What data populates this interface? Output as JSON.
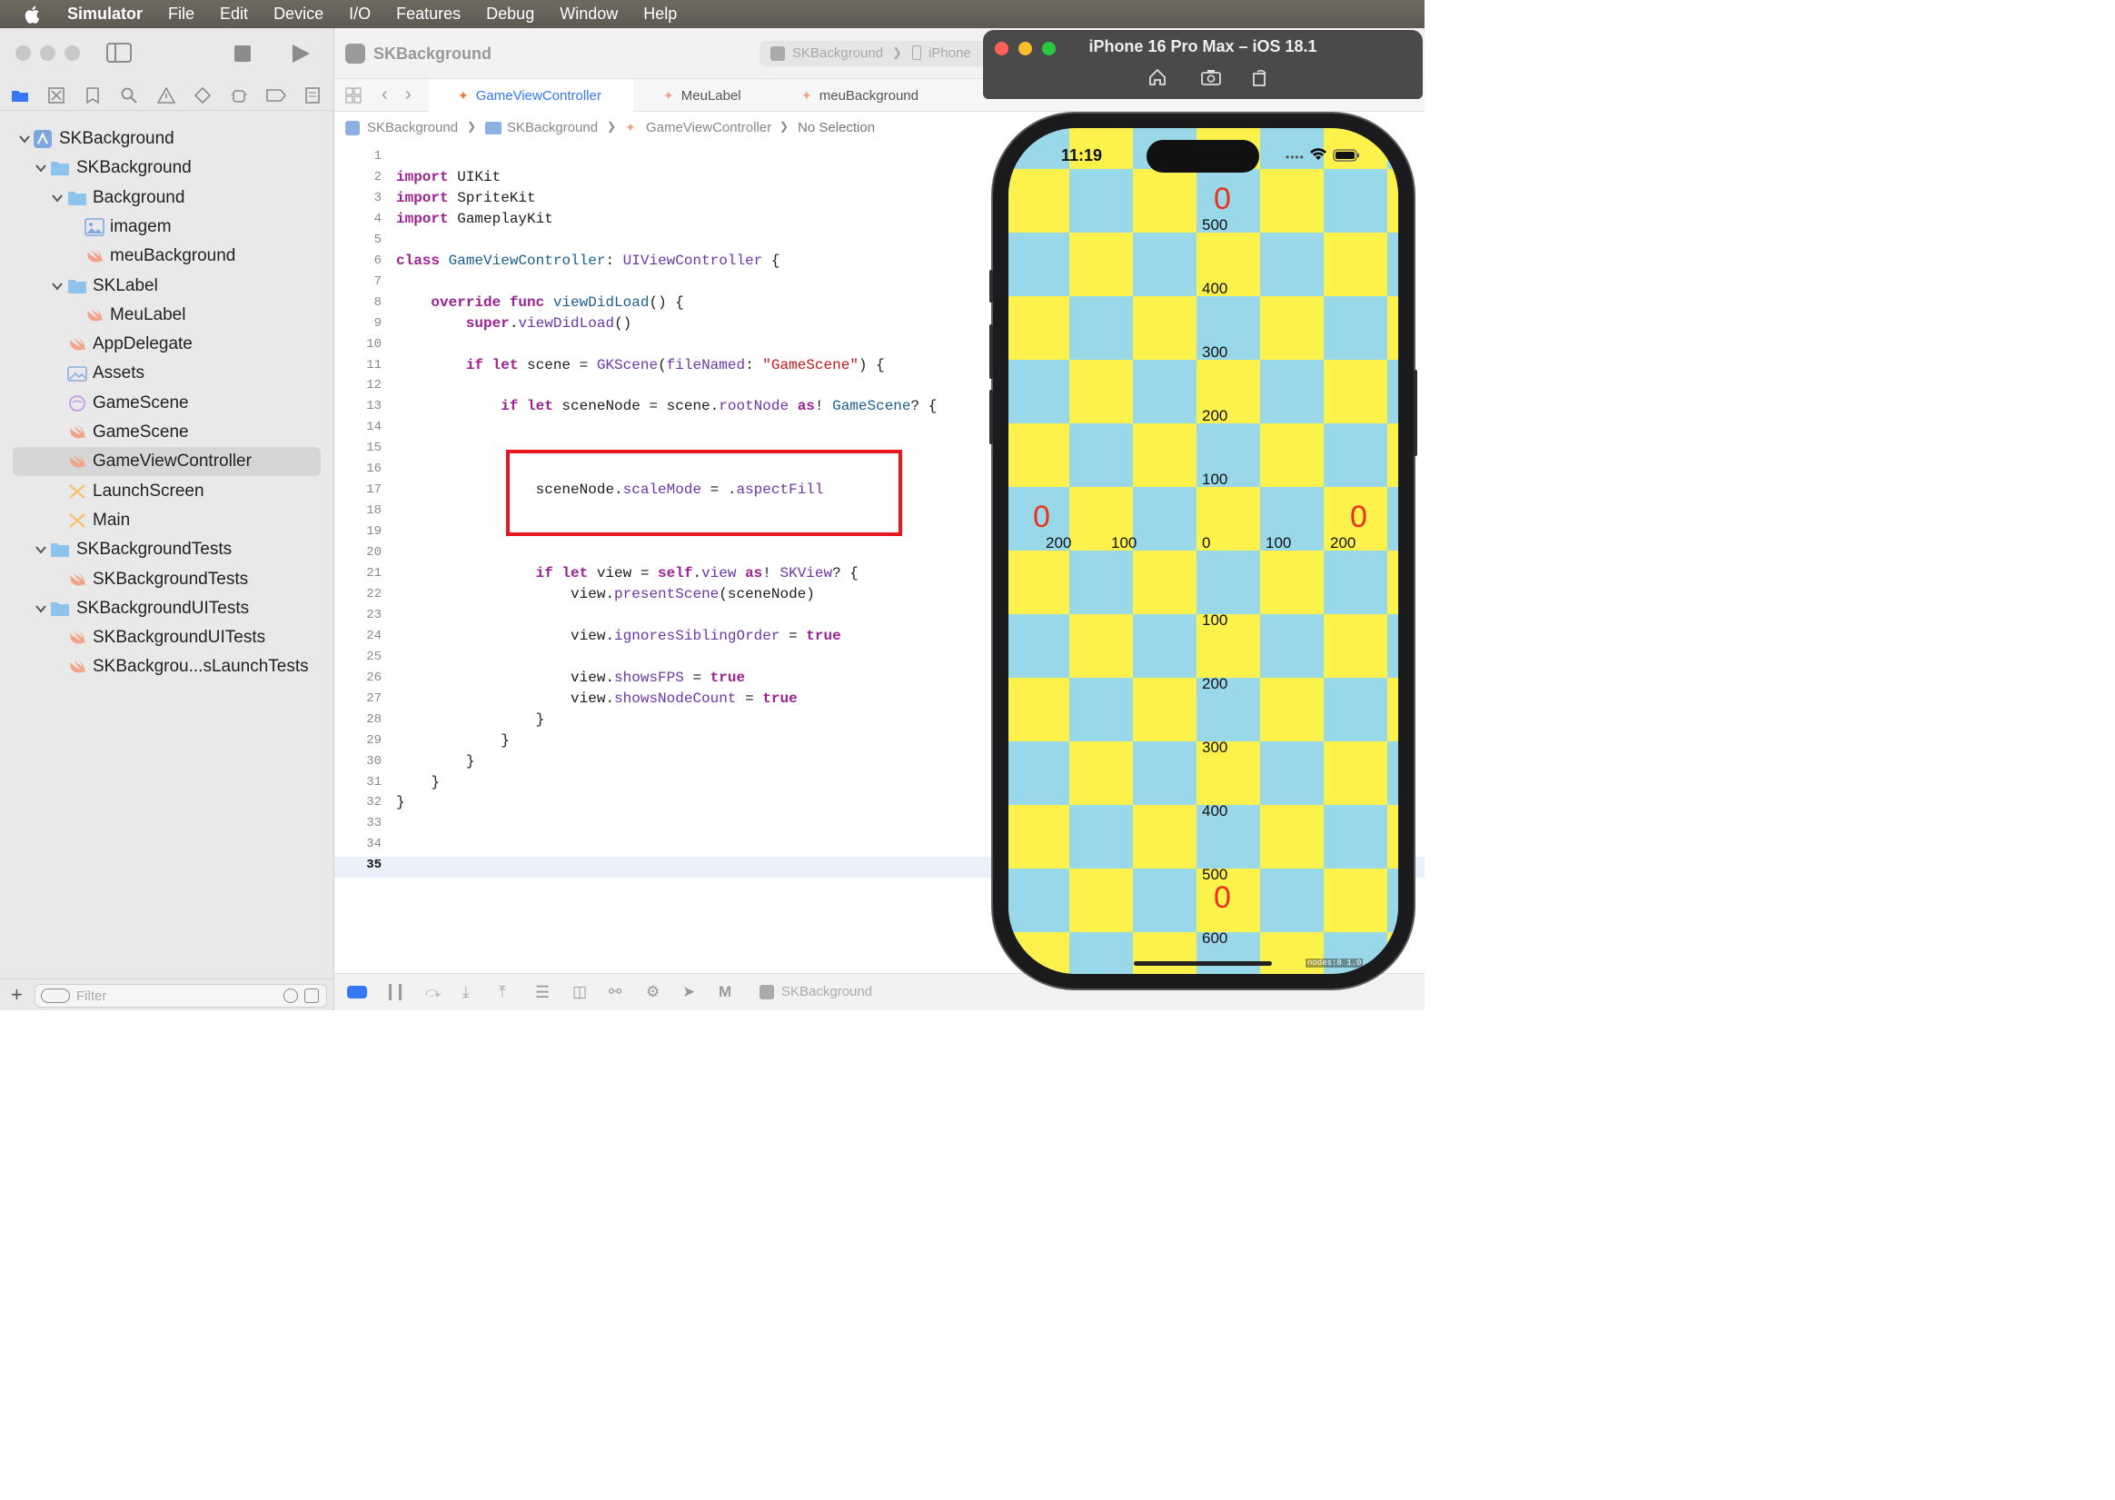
{
  "menubar": {
    "app_name": "Simulator",
    "items": [
      "File",
      "Edit",
      "Device",
      "I/O",
      "Features",
      "Debug",
      "Window",
      "Help"
    ]
  },
  "navigator": {
    "tree": [
      {
        "label": "SKBackground",
        "icon": "project-icon",
        "level": 0,
        "expanded": true
      },
      {
        "label": "SKBackground",
        "icon": "folder-icon",
        "level": 1,
        "expanded": true
      },
      {
        "label": "Background",
        "icon": "folder-icon",
        "level": 2,
        "expanded": true
      },
      {
        "label": "imagem",
        "icon": "image-file-icon",
        "level": 3
      },
      {
        "label": "meuBackground",
        "icon": "swift-file-icon",
        "level": 3
      },
      {
        "label": "SKLabel",
        "icon": "folder-icon",
        "level": 2,
        "expanded": true
      },
      {
        "label": "MeuLabel",
        "icon": "swift-file-icon",
        "level": 3
      },
      {
        "label": "AppDelegate",
        "icon": "swift-file-icon",
        "level": 2
      },
      {
        "label": "Assets",
        "icon": "assets-icon",
        "level": 2
      },
      {
        "label": "GameScene",
        "icon": "sks-scene-icon",
        "level": 2
      },
      {
        "label": "GameScene",
        "icon": "swift-file-icon",
        "level": 2
      },
      {
        "label": "GameViewController",
        "icon": "swift-file-icon",
        "level": 2,
        "selected": true
      },
      {
        "label": "LaunchScreen",
        "icon": "storyboard-icon",
        "level": 2
      },
      {
        "label": "Main",
        "icon": "storyboard-icon",
        "level": 2
      },
      {
        "label": "SKBackgroundTests",
        "icon": "folder-icon",
        "level": 1,
        "expanded": true
      },
      {
        "label": "SKBackgroundTests",
        "icon": "swift-file-icon",
        "level": 2
      },
      {
        "label": "SKBackgroundUITests",
        "icon": "folder-icon",
        "level": 1,
        "expanded": true
      },
      {
        "label": "SKBackgroundUITests",
        "icon": "swift-file-icon",
        "level": 2
      },
      {
        "label": "SKBackgrou...sLaunchTests",
        "icon": "swift-file-icon",
        "level": 2
      }
    ],
    "filter_placeholder": "Filter"
  },
  "editor": {
    "scheme_title": "SKBackground",
    "scheme_selector": "SKBackground",
    "device_selector": "iPhone",
    "tabs": [
      "GameViewController",
      "MeuLabel",
      "meuBackground"
    ],
    "breadcrumb": [
      "SKBackground",
      "SKBackground",
      "GameViewController",
      "No Selection"
    ],
    "current_line": 35,
    "highlight_note_line": 17
  },
  "debugbar": {
    "target": "SKBackground"
  },
  "simulator": {
    "title": "iPhone 16 Pro Max – iOS 18.1",
    "status_time": "11:19",
    "node_count": "nodes:8  1.0",
    "colors": {
      "yellow": "#fdf14c",
      "blue": "#98d8e8",
      "zero_red": "#e8321f"
    },
    "top_zero": "0",
    "bottom_zero": "0",
    "left_zero": "0",
    "right_zero": "0",
    "vertical_labels": [
      "500",
      "400",
      "300",
      "200",
      "100",
      "100",
      "200",
      "300",
      "400",
      "500",
      "600"
    ],
    "horizontal_labels": [
      "200",
      "100",
      "0",
      "100",
      "200"
    ]
  }
}
